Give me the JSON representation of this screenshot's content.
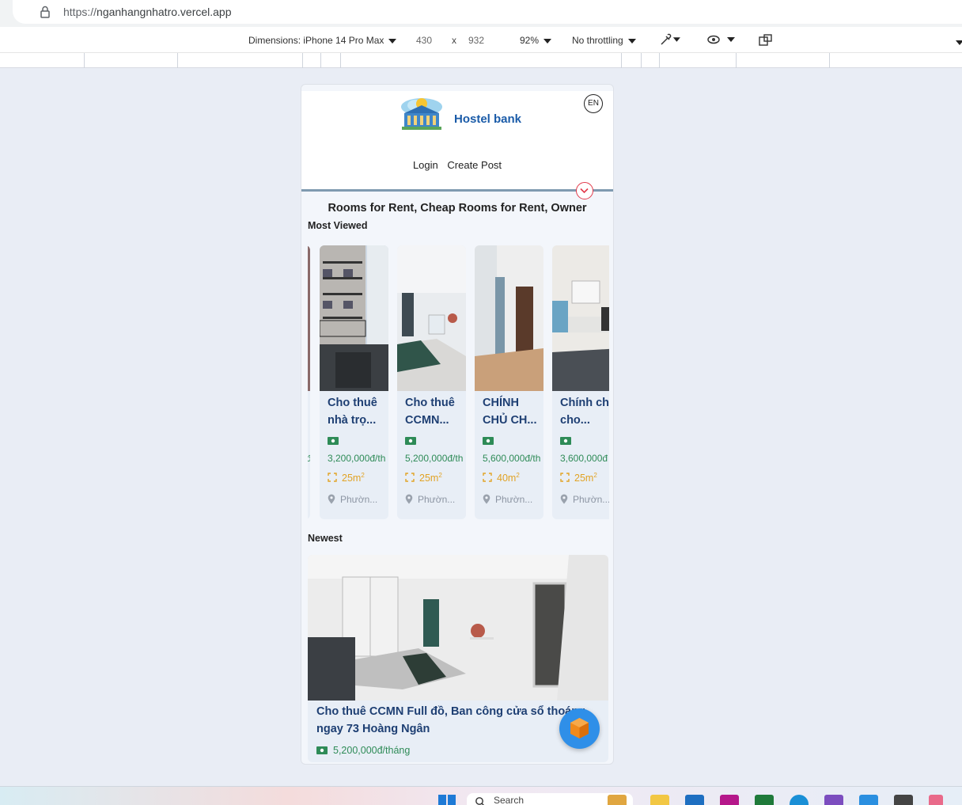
{
  "browser": {
    "url_scheme": "https://",
    "url_host": "nganhangnhatro.vercel.app"
  },
  "devtools": {
    "dimensions_label": "Dimensions: iPhone 14 Pro Max",
    "width": "430",
    "times": "x",
    "height": "932",
    "zoom": "92%",
    "throttling": "No throttling"
  },
  "app": {
    "brand": "Hostel bank",
    "lang": "EN",
    "nav": {
      "login": "Login",
      "create_post": "Create Post"
    },
    "page_title": "Rooms for Rent, Cheap Rooms for Rent, Owner",
    "most_viewed_label": "Most Viewed",
    "newest_label": "Newest",
    "most_viewed": [
      {
        "title": "Cho thuê nhà trọ...",
        "price": "3,200,000đ/th",
        "area": "25m",
        "location": "Phườn..."
      },
      {
        "title": "Cho thuê CCMN...",
        "price": "5,200,000đ/th",
        "area": "25m",
        "location": "Phườn..."
      },
      {
        "title": "CHÍNH CHỦ CH...",
        "price": "5,600,000đ/th",
        "area": "40m",
        "location": "Phườn..."
      },
      {
        "title": "Chính chủ cho...",
        "price": "3,600,000đ",
        "area": "25m",
        "location": "Phườn..."
      }
    ],
    "area_sup": "2",
    "newest": {
      "title": "Cho thuê CCMN Full đồ, Ban công cửa sổ thoáng ngay 73 Hoàng Ngân",
      "price": "5,200,000đ/tháng"
    }
  },
  "taskbar": {
    "search_placeholder": "Search"
  },
  "colors": {
    "accent": "#1a5ba8",
    "price": "#2e8b57",
    "area": "#e1a325",
    "fab": "#2f8fe8"
  }
}
